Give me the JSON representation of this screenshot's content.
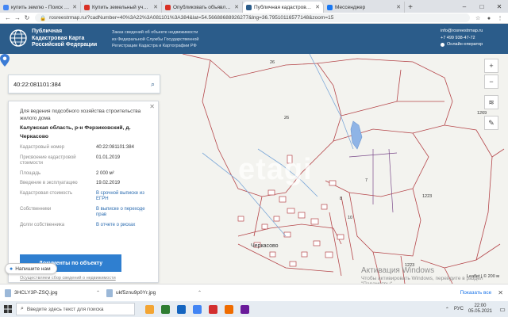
{
  "browser": {
    "tabs": [
      {
        "title": "купить землю - Поиск в Google",
        "color": "#4285f4"
      },
      {
        "title": "Купить земельный участок в Ф...",
        "color": "#d93025"
      },
      {
        "title": "Опубликовать объявление",
        "color": "#d93025"
      },
      {
        "title": "Публичная кадастровая карта",
        "color": "#2b5c8a",
        "active": true
      },
      {
        "title": "Мессенджер",
        "color": "#1877f2"
      }
    ],
    "url": "rosreestrmap.ru/?cadNumber=40%3A22%3A081101%3A384&lat=54.56688688926277&lng=36.79510116577148&zoom=15"
  },
  "header": {
    "logo_lines": [
      "Публичная",
      "Кадастровая Карта",
      "Российской Федерации"
    ],
    "desc_lines": [
      "Заказ сведений об объекте недвижимости",
      "из Федеральной Службы Государственной",
      "Регистрации Кадастра и Картографии РФ"
    ],
    "email": "info@rosreestrmap.ru",
    "phone": "+7 499 938-47-72",
    "online": "Онлайн-оператор"
  },
  "search": {
    "value": "40:22:081101:384"
  },
  "info": {
    "purpose": "Для ведения подсобного хозяйства строительства жилого дома",
    "address": "Калужская область, р-н Ферзиковский, д. Черкасово",
    "rows": [
      {
        "label": "Кадастровый номер",
        "value": "40:22:081101:384",
        "link": false
      },
      {
        "label": "Присвоение кадастровой стоимости",
        "value": "01.01.2019",
        "link": false
      },
      {
        "label": "Площадь",
        "value": "2 000 м²",
        "link": false
      },
      {
        "label": "Введение в эксплуатацию",
        "value": "19.02.2019",
        "link": false
      },
      {
        "label": "Кадастровая стоимость",
        "value": "В срочной выписке из ЕГРН",
        "link": true
      },
      {
        "label": "Собственники",
        "value": "В выписке о переходе прав",
        "link": true
      },
      {
        "label": "Долги собственника",
        "value": "В отчете о рисках",
        "link": true
      }
    ],
    "button": "Документы по объекту",
    "footer": "Осуществляем сбор сведений о недвижимости"
  },
  "chat": {
    "label": "Напишите нам"
  },
  "map": {
    "watermark": "etagi",
    "activate_title": "Активация Windows",
    "activate_sub": "Чтобы активировать Windows, перейдите в раздел \"Параметры\".",
    "scale": "Leaflet | © 200 м",
    "parcel_labels": [
      "26",
      "26",
      "1269",
      "7",
      "8",
      "10",
      "1223",
      "1223",
      "Черкасово"
    ]
  },
  "downloads": [
    {
      "name": "3HCLY3P-ZSQ.jpg"
    },
    {
      "name": "ukf5znu9p0Yr.jpg"
    }
  ],
  "downloads_showall": "Показать все",
  "taskbar": {
    "search_placeholder": "Введите здесь текст для поиска",
    "apps": [
      "#f3a533",
      "#2e7d32",
      "#1565c0",
      "#4285f4",
      "#d32f2f",
      "#ef6c00",
      "#6a1b9a"
    ],
    "lang": "РУС",
    "time": "22:00",
    "date": "05.05.2021"
  }
}
